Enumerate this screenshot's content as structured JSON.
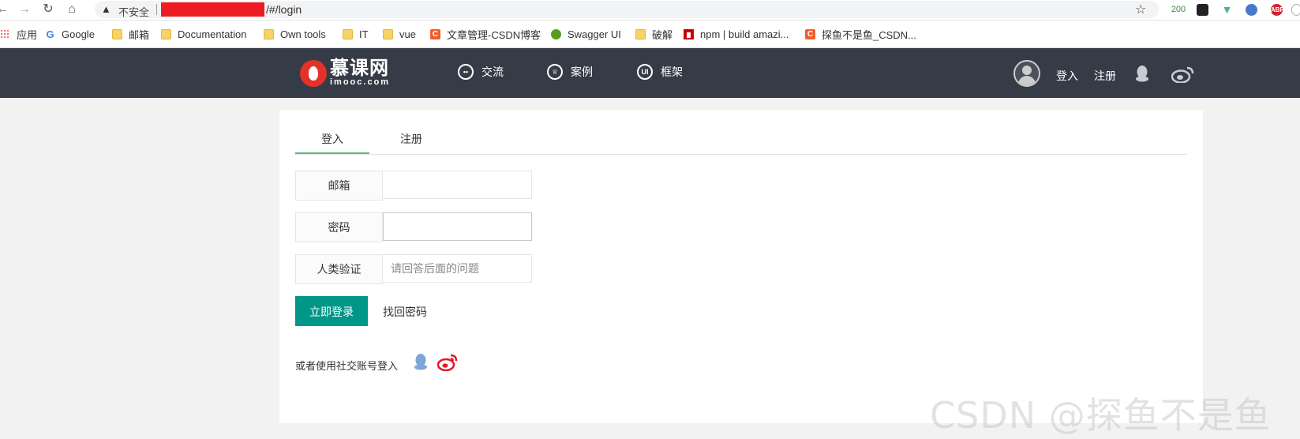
{
  "browser": {
    "security_label": "不安全",
    "url_path": "/#/login",
    "extension_badge": "200",
    "abp_label": "ABP"
  },
  "bookmarks": [
    {
      "label": "应用",
      "icon": "apps-grid-icon"
    },
    {
      "label": "Google",
      "icon": "google-icon"
    },
    {
      "label": "邮箱",
      "icon": "folder-icon"
    },
    {
      "label": "Documentation",
      "icon": "folder-icon"
    },
    {
      "label": "Own tools",
      "icon": "folder-icon"
    },
    {
      "label": "IT",
      "icon": "folder-icon"
    },
    {
      "label": "vue",
      "icon": "folder-icon"
    },
    {
      "label": "文章管理-CSDN博客",
      "icon": "csdn-icon"
    },
    {
      "label": "Swagger UI",
      "icon": "swagger-icon"
    },
    {
      "label": "破解",
      "icon": "folder-icon"
    },
    {
      "label": "npm | build amazi...",
      "icon": "npm-icon"
    },
    {
      "label": "探鱼不是鱼_CSDN...",
      "icon": "csdn-icon"
    }
  ],
  "header": {
    "logo_cn": "慕课网",
    "logo_en": "imooc.com",
    "menu": [
      {
        "label": "交流",
        "icon": "chat-icon"
      },
      {
        "label": "案例",
        "icon": "crown-icon"
      },
      {
        "label": "框架",
        "icon": "ui-icon"
      }
    ],
    "login": "登入",
    "register": "注册"
  },
  "form": {
    "tabs": [
      "登入",
      "注册"
    ],
    "email_label": "邮箱",
    "email_value": "",
    "password_label": "密码",
    "password_value": "",
    "captcha_label": "人类验证",
    "captcha_placeholder": "请回答后面的问题",
    "submit": "立即登录",
    "forgot": "找回密码",
    "social_text": "或者使用社交账号登入"
  },
  "watermark": "CSDN @探鱼不是鱼",
  "colors": {
    "header_bg": "#363c47",
    "primary_button": "#009688",
    "tab_underline": "#5fb878",
    "weibo": "#e6162d",
    "qq": "#7da5d6"
  }
}
